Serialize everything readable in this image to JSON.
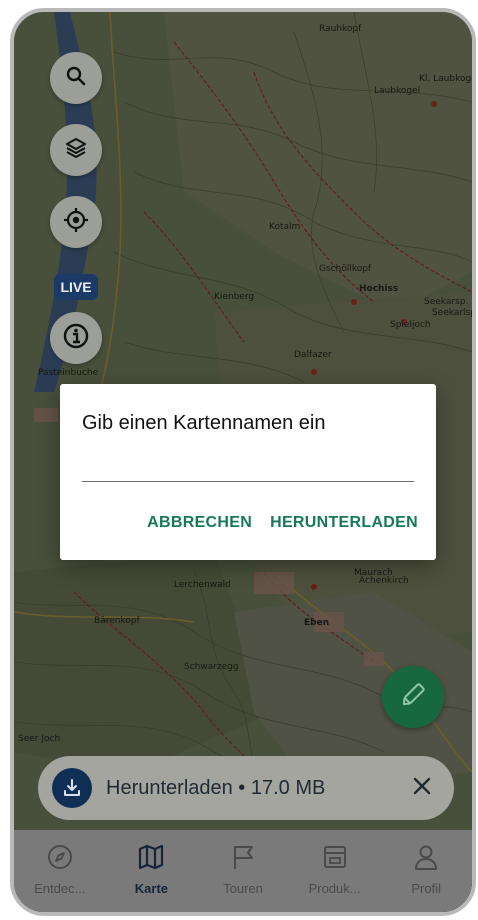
{
  "map": {
    "labels": [
      "Rauhkopf",
      "Laubkogel",
      "Kl. Laubkogel",
      "Seekarsp.",
      "Hochiss",
      "Spieljoch",
      "Dalfazer",
      "Gschöllkopf",
      "Kotalm",
      "Maurach",
      "Eben",
      "Achenkirch",
      "Bärenkopf",
      "Schwarzegg",
      "Lerchenwald",
      "Seer Joch",
      "Pasteinbuche",
      "Kienberg",
      "Seekarlsp."
    ]
  },
  "controls": {
    "search_icon": "search-icon",
    "layers_icon": "layers-icon",
    "locate_icon": "crosshair-icon",
    "live_label": "LIVE",
    "info_icon": "info-icon"
  },
  "dialog": {
    "title": "Gib einen Kartennamen ein",
    "input_value": "",
    "input_placeholder": "",
    "cancel_label": "ABBRECHEN",
    "confirm_label": "HERUNTERLADEN"
  },
  "download": {
    "label": "Herunterladen • 17.0 MB"
  },
  "nav": {
    "items": [
      {
        "label": "Entdec...",
        "icon": "compass-icon"
      },
      {
        "label": "Karte",
        "icon": "map-icon"
      },
      {
        "label": "Touren",
        "icon": "flag-icon"
      },
      {
        "label": "Produk...",
        "icon": "store-icon"
      },
      {
        "label": "Profil",
        "icon": "person-icon"
      }
    ],
    "active_index": 1
  },
  "colors": {
    "accent": "#17795a",
    "fab": "#17683f",
    "navy": "#0f2f55"
  }
}
